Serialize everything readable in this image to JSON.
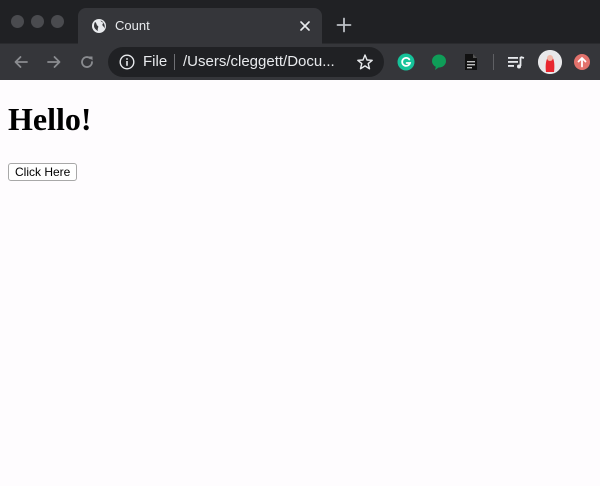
{
  "tab": {
    "title": "Count",
    "favicon": "globe-icon"
  },
  "omnibox": {
    "scheme_label": "File",
    "url": "/Users/cleggett/Docu..."
  },
  "page": {
    "heading": "Hello!",
    "button_label": "Click Here"
  },
  "colors": {
    "tabstrip_bg": "#202124",
    "toolbar_bg": "#35363a",
    "omnibox_bg": "#202124",
    "grammarly_green": "#15c39a",
    "bubble_green": "#0f9d58",
    "update_red": "#e2726c",
    "page_bg": "#fefcfe"
  },
  "extensions": [
    "grammarly-icon",
    "chat-bubble-icon",
    "document-icon",
    "media-queue-icon",
    "avatar",
    "update-icon"
  ]
}
